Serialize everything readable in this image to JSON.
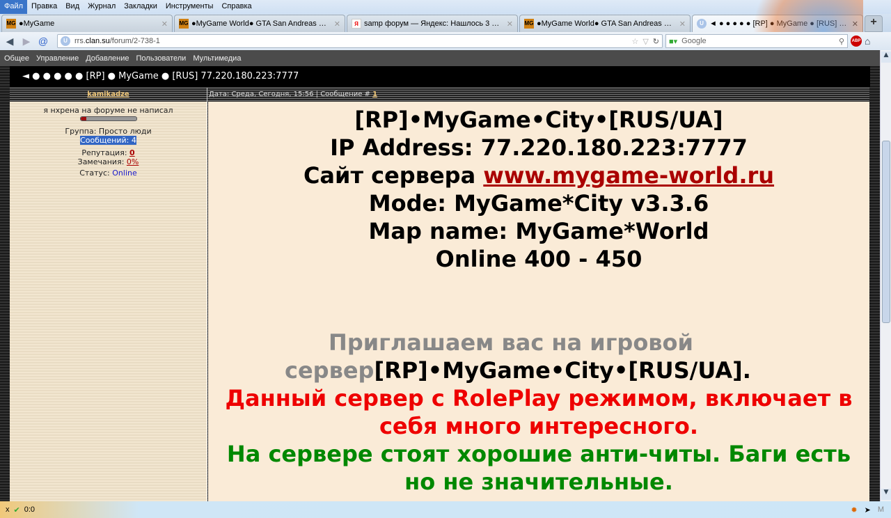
{
  "menu": [
    "Файл",
    "Правка",
    "Вид",
    "Журнал",
    "Закладки",
    "Инструменты",
    "Справка"
  ],
  "tabs": [
    {
      "title": "●MyGame",
      "icon": "MG"
    },
    {
      "title": "●MyGame World● GTA San Andreas Mul...",
      "icon": "MG"
    },
    {
      "title": "samp форум — Яндекс: Нашлось 3 млн...",
      "icon": "Я"
    },
    {
      "title": "●MyGame World● GTA San Andreas Mul...",
      "icon": "MG"
    },
    {
      "title": "◄ ● ● ● ● ● [RP] ● MyGame ● [RUS] 7...",
      "icon": "U"
    }
  ],
  "url": {
    "pre": "rrs.",
    "domain": "clan.su",
    "path": "/forum/2-738-1"
  },
  "search": {
    "placeholder": "Google"
  },
  "forum_nav": [
    "Общее",
    "Управление",
    "Добавление",
    "Пользователи",
    "Мультимедиа"
  ],
  "thread_title": "◄ ● ● ● ● ● [RP] ● MyGame ● [RUS] 77.220.180.223:7777",
  "post": {
    "author": "kamikadze",
    "date": "Дата: Среда, Сегодня, 15:56 | Сообщение #",
    "number": "1",
    "user_title": "я нхрена на форуме не написал",
    "rank_progress": 0.1,
    "group": "Группа: Просто люди",
    "messages": "Сообщений: 4",
    "rep_label": "Репутация:",
    "rep_value": "0",
    "warn_label": "Замечания:",
    "warn_value": "0%",
    "status_label": "Статус:",
    "status_value": "Online",
    "lines": {
      "l1": "[RP]•MyGame•City•[RUS/UA]",
      "l2": "IP Address: 77.220.180.223:7777",
      "l3a": "Сайт сервера ",
      "l3b": "www.mygame-world.ru",
      "l4": "Mode: MyGame*City v3.3.6",
      "l5": "Map name: MyGame*World",
      "l6": "Online 400 - 450",
      "l7a": "Приглашаем вас на игровой сервер",
      "l7b": "[RP]•MyGame•City•[RUS/UA].",
      "l8": "Данный сервер с RolePlay режимом, включает в себя много интересного.",
      "l9": "На сервере стоят хорошие анти-читы. Баги есть но не значительные."
    }
  },
  "statusbar": {
    "close": "x",
    "counter": "0:0"
  }
}
